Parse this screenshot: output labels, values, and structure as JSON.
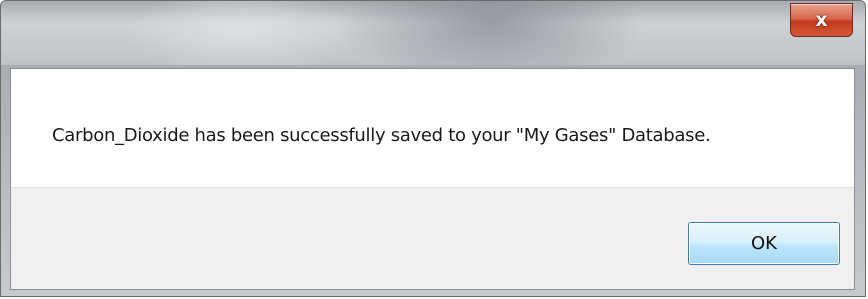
{
  "dialog": {
    "title": "",
    "close_label": "x",
    "message": "Carbon_Dioxide has been successfully saved to your \"My Gases\" Database.",
    "ok_label": "OK"
  },
  "colors": {
    "close_button": "#c2391c",
    "ok_button_border": "#3c7fb1",
    "button_area_bg": "#f0f0f0"
  }
}
